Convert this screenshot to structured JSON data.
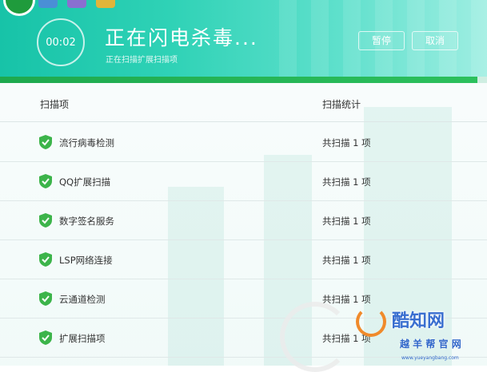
{
  "header": {
    "timer": "00:02",
    "title": "正在闪电杀毒...",
    "subtitle": "正在扫描扩展扫描项",
    "pause_label": "暂停",
    "cancel_label": "取消",
    "progress_fraction": 0.98
  },
  "table": {
    "col_item": "扫描项",
    "col_stats": "扫描统计",
    "rows": [
      {
        "name": "流行病毒检测",
        "stat": "共扫描 1 项"
      },
      {
        "name": "QQ扩展扫描",
        "stat": "共扫描 1 项"
      },
      {
        "name": "数字签名服务",
        "stat": "共扫描 1 项"
      },
      {
        "name": "LSP网络连接",
        "stat": "共扫描 1 项"
      },
      {
        "name": "云通道检测",
        "stat": "共扫描 1 项"
      },
      {
        "name": "扩展扫描项",
        "stat": "共扫描 1 项"
      }
    ]
  },
  "watermark": {
    "name": "酷知网",
    "sub": "越 羊 帮 官 网",
    "url": "www.yueyangbang.com"
  },
  "colors": {
    "accent": "#2fd2b6",
    "progress": "#1ea94e",
    "shield": "#3cb44a"
  }
}
